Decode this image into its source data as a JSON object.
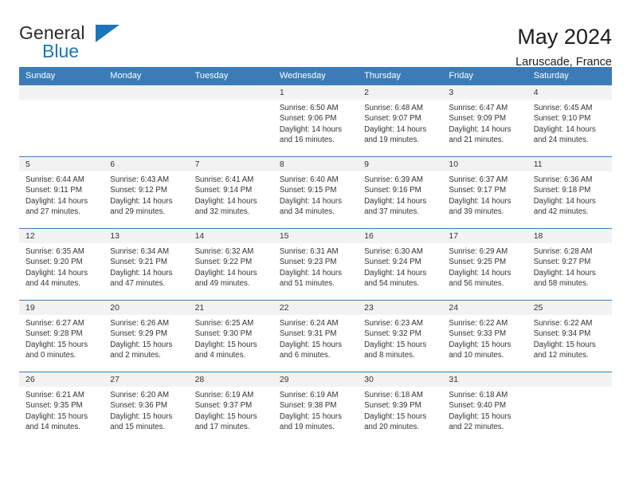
{
  "brand": {
    "line1": "General",
    "line2": "Blue",
    "flag_icon": "triangle-flag-icon",
    "accent_color": "#1a76bc"
  },
  "header": {
    "title": "May 2024",
    "subtitle": "Laruscade, France"
  },
  "calendar": {
    "header_bg": "#3b7cb8",
    "daynum_bg": "#f2f2f2",
    "weekday_headers": [
      "Sunday",
      "Monday",
      "Tuesday",
      "Wednesday",
      "Thursday",
      "Friday",
      "Saturday"
    ],
    "weeks": [
      [
        {
          "day": "",
          "sunrise": "",
          "sunset": "",
          "daylight1": "",
          "daylight2": ""
        },
        {
          "day": "",
          "sunrise": "",
          "sunset": "",
          "daylight1": "",
          "daylight2": ""
        },
        {
          "day": "",
          "sunrise": "",
          "sunset": "",
          "daylight1": "",
          "daylight2": ""
        },
        {
          "day": "1",
          "sunrise": "Sunrise: 6:50 AM",
          "sunset": "Sunset: 9:06 PM",
          "daylight1": "Daylight: 14 hours",
          "daylight2": "and 16 minutes."
        },
        {
          "day": "2",
          "sunrise": "Sunrise: 6:48 AM",
          "sunset": "Sunset: 9:07 PM",
          "daylight1": "Daylight: 14 hours",
          "daylight2": "and 19 minutes."
        },
        {
          "day": "3",
          "sunrise": "Sunrise: 6:47 AM",
          "sunset": "Sunset: 9:09 PM",
          "daylight1": "Daylight: 14 hours",
          "daylight2": "and 21 minutes."
        },
        {
          "day": "4",
          "sunrise": "Sunrise: 6:45 AM",
          "sunset": "Sunset: 9:10 PM",
          "daylight1": "Daylight: 14 hours",
          "daylight2": "and 24 minutes."
        }
      ],
      [
        {
          "day": "5",
          "sunrise": "Sunrise: 6:44 AM",
          "sunset": "Sunset: 9:11 PM",
          "daylight1": "Daylight: 14 hours",
          "daylight2": "and 27 minutes."
        },
        {
          "day": "6",
          "sunrise": "Sunrise: 6:43 AM",
          "sunset": "Sunset: 9:12 PM",
          "daylight1": "Daylight: 14 hours",
          "daylight2": "and 29 minutes."
        },
        {
          "day": "7",
          "sunrise": "Sunrise: 6:41 AM",
          "sunset": "Sunset: 9:14 PM",
          "daylight1": "Daylight: 14 hours",
          "daylight2": "and 32 minutes."
        },
        {
          "day": "8",
          "sunrise": "Sunrise: 6:40 AM",
          "sunset": "Sunset: 9:15 PM",
          "daylight1": "Daylight: 14 hours",
          "daylight2": "and 34 minutes."
        },
        {
          "day": "9",
          "sunrise": "Sunrise: 6:39 AM",
          "sunset": "Sunset: 9:16 PM",
          "daylight1": "Daylight: 14 hours",
          "daylight2": "and 37 minutes."
        },
        {
          "day": "10",
          "sunrise": "Sunrise: 6:37 AM",
          "sunset": "Sunset: 9:17 PM",
          "daylight1": "Daylight: 14 hours",
          "daylight2": "and 39 minutes."
        },
        {
          "day": "11",
          "sunrise": "Sunrise: 6:36 AM",
          "sunset": "Sunset: 9:18 PM",
          "daylight1": "Daylight: 14 hours",
          "daylight2": "and 42 minutes."
        }
      ],
      [
        {
          "day": "12",
          "sunrise": "Sunrise: 6:35 AM",
          "sunset": "Sunset: 9:20 PM",
          "daylight1": "Daylight: 14 hours",
          "daylight2": "and 44 minutes."
        },
        {
          "day": "13",
          "sunrise": "Sunrise: 6:34 AM",
          "sunset": "Sunset: 9:21 PM",
          "daylight1": "Daylight: 14 hours",
          "daylight2": "and 47 minutes."
        },
        {
          "day": "14",
          "sunrise": "Sunrise: 6:32 AM",
          "sunset": "Sunset: 9:22 PM",
          "daylight1": "Daylight: 14 hours",
          "daylight2": "and 49 minutes."
        },
        {
          "day": "15",
          "sunrise": "Sunrise: 6:31 AM",
          "sunset": "Sunset: 9:23 PM",
          "daylight1": "Daylight: 14 hours",
          "daylight2": "and 51 minutes."
        },
        {
          "day": "16",
          "sunrise": "Sunrise: 6:30 AM",
          "sunset": "Sunset: 9:24 PM",
          "daylight1": "Daylight: 14 hours",
          "daylight2": "and 54 minutes."
        },
        {
          "day": "17",
          "sunrise": "Sunrise: 6:29 AM",
          "sunset": "Sunset: 9:25 PM",
          "daylight1": "Daylight: 14 hours",
          "daylight2": "and 56 minutes."
        },
        {
          "day": "18",
          "sunrise": "Sunrise: 6:28 AM",
          "sunset": "Sunset: 9:27 PM",
          "daylight1": "Daylight: 14 hours",
          "daylight2": "and 58 minutes."
        }
      ],
      [
        {
          "day": "19",
          "sunrise": "Sunrise: 6:27 AM",
          "sunset": "Sunset: 9:28 PM",
          "daylight1": "Daylight: 15 hours",
          "daylight2": "and 0 minutes."
        },
        {
          "day": "20",
          "sunrise": "Sunrise: 6:26 AM",
          "sunset": "Sunset: 9:29 PM",
          "daylight1": "Daylight: 15 hours",
          "daylight2": "and 2 minutes."
        },
        {
          "day": "21",
          "sunrise": "Sunrise: 6:25 AM",
          "sunset": "Sunset: 9:30 PM",
          "daylight1": "Daylight: 15 hours",
          "daylight2": "and 4 minutes."
        },
        {
          "day": "22",
          "sunrise": "Sunrise: 6:24 AM",
          "sunset": "Sunset: 9:31 PM",
          "daylight1": "Daylight: 15 hours",
          "daylight2": "and 6 minutes."
        },
        {
          "day": "23",
          "sunrise": "Sunrise: 6:23 AM",
          "sunset": "Sunset: 9:32 PM",
          "daylight1": "Daylight: 15 hours",
          "daylight2": "and 8 minutes."
        },
        {
          "day": "24",
          "sunrise": "Sunrise: 6:22 AM",
          "sunset": "Sunset: 9:33 PM",
          "daylight1": "Daylight: 15 hours",
          "daylight2": "and 10 minutes."
        },
        {
          "day": "25",
          "sunrise": "Sunrise: 6:22 AM",
          "sunset": "Sunset: 9:34 PM",
          "daylight1": "Daylight: 15 hours",
          "daylight2": "and 12 minutes."
        }
      ],
      [
        {
          "day": "26",
          "sunrise": "Sunrise: 6:21 AM",
          "sunset": "Sunset: 9:35 PM",
          "daylight1": "Daylight: 15 hours",
          "daylight2": "and 14 minutes."
        },
        {
          "day": "27",
          "sunrise": "Sunrise: 6:20 AM",
          "sunset": "Sunset: 9:36 PM",
          "daylight1": "Daylight: 15 hours",
          "daylight2": "and 15 minutes."
        },
        {
          "day": "28",
          "sunrise": "Sunrise: 6:19 AM",
          "sunset": "Sunset: 9:37 PM",
          "daylight1": "Daylight: 15 hours",
          "daylight2": "and 17 minutes."
        },
        {
          "day": "29",
          "sunrise": "Sunrise: 6:19 AM",
          "sunset": "Sunset: 9:38 PM",
          "daylight1": "Daylight: 15 hours",
          "daylight2": "and 19 minutes."
        },
        {
          "day": "30",
          "sunrise": "Sunrise: 6:18 AM",
          "sunset": "Sunset: 9:39 PM",
          "daylight1": "Daylight: 15 hours",
          "daylight2": "and 20 minutes."
        },
        {
          "day": "31",
          "sunrise": "Sunrise: 6:18 AM",
          "sunset": "Sunset: 9:40 PM",
          "daylight1": "Daylight: 15 hours",
          "daylight2": "and 22 minutes."
        },
        {
          "day": "",
          "sunrise": "",
          "sunset": "",
          "daylight1": "",
          "daylight2": ""
        }
      ]
    ]
  }
}
